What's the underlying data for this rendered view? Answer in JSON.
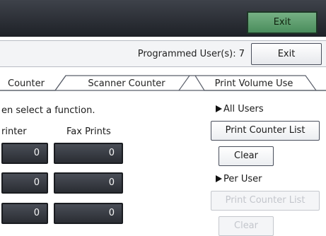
{
  "header": {
    "exit_label": "Exit"
  },
  "subheader": {
    "programmed_users": "Programmed User(s): 7",
    "exit_label": "Exit"
  },
  "tabs": [
    {
      "label": "Counter"
    },
    {
      "label": "Scanner Counter"
    },
    {
      "label": "Print Volume Use"
    }
  ],
  "main": {
    "instruction": "en select a function.",
    "columns": [
      "rinter",
      "Fax Prints"
    ],
    "rows": [
      {
        "printer": "0",
        "fax": "0"
      },
      {
        "printer": "0",
        "fax": "0"
      },
      {
        "printer": "0",
        "fax": "0"
      }
    ]
  },
  "side": {
    "all_users_label": "All Users",
    "print_counter_list": "Print Counter List",
    "clear": "Clear",
    "per_user_label": "Per User",
    "per_user_print_counter_list": "Print Counter List",
    "per_user_clear": "Clear"
  }
}
